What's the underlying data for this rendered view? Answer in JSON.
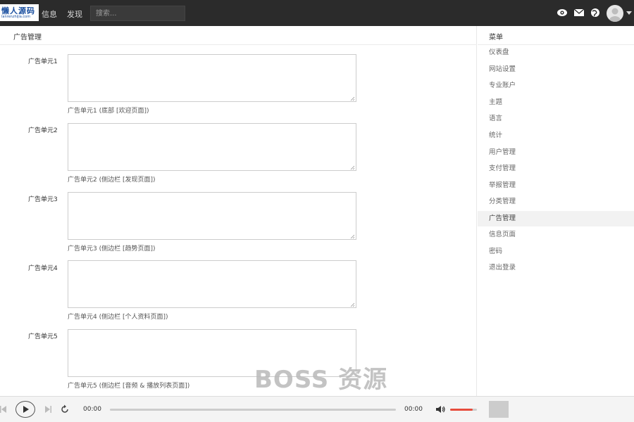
{
  "logo": {
    "line1": "懒人源码",
    "line2": "lanrenzhijia.com"
  },
  "nav": {
    "messages": "信息",
    "discover": "发现"
  },
  "search": {
    "placeholder": "搜索..."
  },
  "main": {
    "title": "广告管理",
    "fields": [
      {
        "label": "广告单元1",
        "help": "广告单元1 (底部 [欢迎页面])",
        "value": ""
      },
      {
        "label": "广告单元2",
        "help": "广告单元2 (侧边栏 [发现页面])",
        "value": ""
      },
      {
        "label": "广告单元3",
        "help": "广告单元3 (侧边栏 [趋势页面])",
        "value": ""
      },
      {
        "label": "广告单元4",
        "help": "广告单元4 (侧边栏 [个人资料页面])",
        "value": ""
      },
      {
        "label": "广告单元5",
        "help": "广告单元5 (侧边栏 [音频 & 播放列表页面])",
        "value": ""
      }
    ]
  },
  "sidebar": {
    "title": "菜单",
    "items": [
      {
        "label": "仪表盘"
      },
      {
        "label": "网站设置"
      },
      {
        "label": "专业账户"
      },
      {
        "label": "主题"
      },
      {
        "label": "语言"
      },
      {
        "label": "统计"
      },
      {
        "label": "用户管理"
      },
      {
        "label": "支付管理"
      },
      {
        "label": "举报管理"
      },
      {
        "label": "分类管理"
      },
      {
        "label": "广告管理",
        "active": true
      },
      {
        "label": "信息页面"
      },
      {
        "label": "密码"
      },
      {
        "label": "退出登录"
      }
    ]
  },
  "player": {
    "current_time": "00:00",
    "duration": "00:00",
    "progress_fraction": 0,
    "volume_fraction": 0.85,
    "accent_color": "#e74c3c"
  },
  "watermark": "BOSS 资源",
  "icons": {
    "top": [
      "eye-icon",
      "mail-icon",
      "globe-icon"
    ],
    "player": [
      "previous-icon",
      "play-icon",
      "next-icon",
      "repeat-icon",
      "volume-icon"
    ]
  }
}
